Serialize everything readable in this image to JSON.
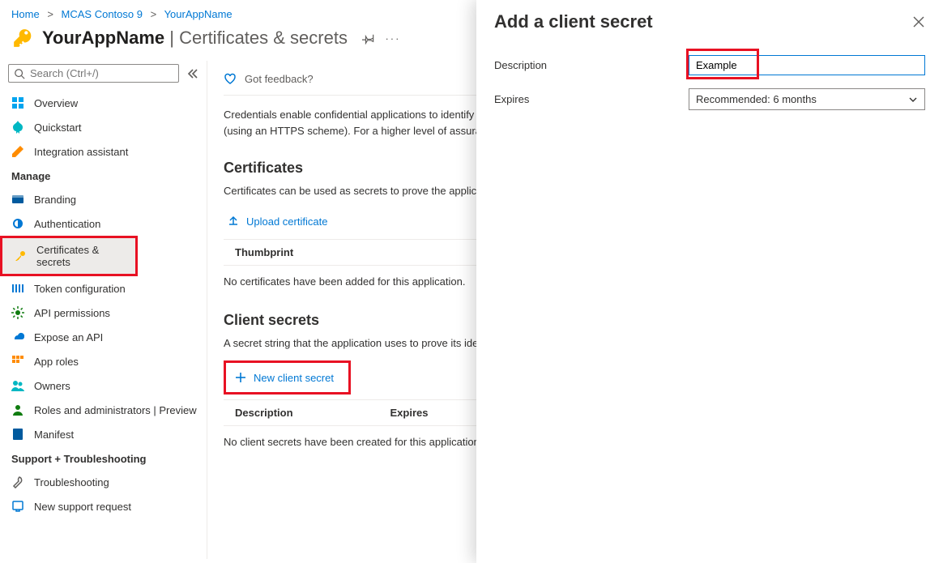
{
  "breadcrumb": {
    "home": "Home",
    "org": "MCAS Contoso 9",
    "app": "YourAppName"
  },
  "header": {
    "app_name": "YourAppName",
    "page_name": "Certificates & secrets"
  },
  "search": {
    "placeholder": "Search (Ctrl+/)"
  },
  "sidebar": {
    "items_top": [
      {
        "label": "Overview"
      },
      {
        "label": "Quickstart"
      },
      {
        "label": "Integration assistant"
      }
    ],
    "manage_header": "Manage",
    "items_manage": [
      {
        "label": "Branding"
      },
      {
        "label": "Authentication"
      },
      {
        "label": "Certificates & secrets"
      },
      {
        "label": "Token configuration"
      },
      {
        "label": "API permissions"
      },
      {
        "label": "Expose an API"
      },
      {
        "label": "App roles"
      },
      {
        "label": "Owners"
      },
      {
        "label": "Roles and administrators | Preview"
      },
      {
        "label": "Manifest"
      }
    ],
    "support_header": "Support + Troubleshooting",
    "items_support": [
      {
        "label": "Troubleshooting"
      },
      {
        "label": "New support request"
      }
    ]
  },
  "content": {
    "feedback": "Got feedback?",
    "intro": "Credentials enable confidential applications to identify themselves to the authentication service when receiving tokens at a web addressable location (using an HTTPS scheme). For a higher level of assurance, we recommend using a certificate (instead of a client secret) as a credential.",
    "certs": {
      "title": "Certificates",
      "desc": "Certificates can be used as secrets to prove the application's identity when requesting a token. Also can be referred to as public keys.",
      "upload": "Upload certificate",
      "col_thumb": "Thumbprint",
      "empty": "No certificates have been added for this application."
    },
    "secrets": {
      "title": "Client secrets",
      "desc": "A secret string that the application uses to prove its identity when requesting a token. Also can be referred to as application password.",
      "new": "New client secret",
      "col_desc": "Description",
      "col_exp": "Expires",
      "empty": "No client secrets have been created for this application."
    }
  },
  "panel": {
    "title": "Add a client secret",
    "desc_label": "Description",
    "desc_value": "Example",
    "exp_label": "Expires",
    "exp_value": "Recommended: 6 months"
  }
}
